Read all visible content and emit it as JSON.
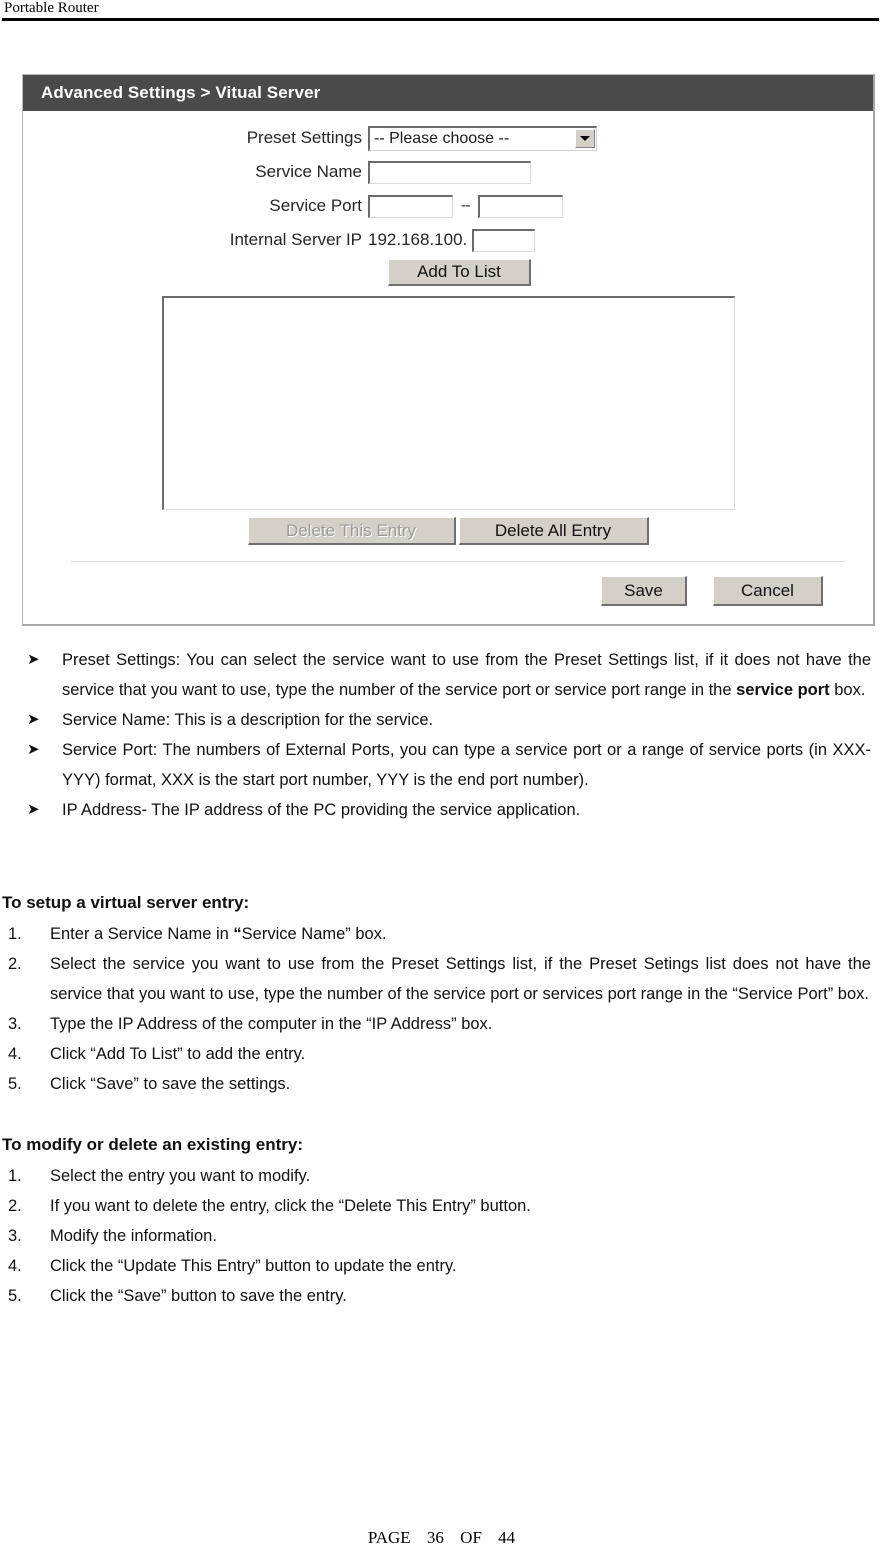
{
  "document": {
    "running_header": "Portable Router",
    "footer": {
      "page_word": "PAGE",
      "page_number": "36",
      "of_word": "OF",
      "total_pages": "44"
    }
  },
  "router_ui": {
    "titlebar": "Advanced Settings > Vitual Server",
    "form": {
      "preset_settings_label": "Preset Settings",
      "preset_settings_value": "-- Please choose --",
      "preset_settings_options": [
        "-- Please choose --"
      ],
      "service_name_label": "Service Name",
      "service_name_value": "",
      "service_port_label": "Service Port",
      "service_port_start_value": "",
      "service_port_end_value": "",
      "service_port_separator": "--",
      "internal_server_ip_label": "Internal Server IP",
      "internal_server_ip_prefix": "192.168.100.",
      "internal_server_ip_host_value": ""
    },
    "buttons": {
      "add_to_list": "Add To List",
      "delete_this_entry": "Delete This Entry",
      "delete_all_entry": "Delete All Entry",
      "save": "Save",
      "cancel": "Cancel"
    },
    "entry_list": {
      "items": []
    },
    "colors": {
      "titlebar_bg": "#4a4a4a",
      "titlebar_text": "#ffffff",
      "button_face": "#d4d0c8",
      "panel_bg": "#ffffff",
      "disabled_text": "#9a9a9a"
    }
  },
  "content": {
    "bullets": [
      {
        "pre": "Preset Settings: You can select the service want to use from the Preset Settings list, if it does not have the service that you want to use, type the number of the service port or service port range in the ",
        "bold": "service port",
        "post": " box."
      },
      {
        "pre": "Service Name: This is a description for the service.",
        "bold": "",
        "post": ""
      },
      {
        "pre": "Service Port: The numbers of External Ports, you can type a service port or a range of service ports (in XXX-YYY) format, XXX is the start port number, YYY is the end port number).",
        "bold": "",
        "post": ""
      },
      {
        "pre": "IP Address- The IP address of the PC providing the service application.",
        "bold": "",
        "post": ""
      }
    ],
    "setup_section": {
      "title": "To setup a virtual server entry:",
      "steps": [
        {
          "num": "1.",
          "pre": "Enter a Service Name in ",
          "bold": "“",
          "post": "Service Name” box."
        },
        {
          "num": "2.",
          "pre": "Select the service you want to use from the Preset Settings list, if the Preset Setings list does not have the service that you want to use, type the number of the service port or services port range in the “Service Port” box.",
          "bold": "",
          "post": ""
        },
        {
          "num": "3.",
          "pre": "Type the IP Address of the computer in the “IP Address” box.",
          "bold": "",
          "post": ""
        },
        {
          "num": "4.",
          "pre": "Click “Add To List” to add the entry.",
          "bold": "",
          "post": ""
        },
        {
          "num": "5.",
          "pre": "Click “Save” to save the settings.",
          "bold": "",
          "post": ""
        }
      ]
    },
    "modify_section": {
      "title": "To modify or delete an existing entry:",
      "steps": [
        {
          "num": "1.",
          "pre": "Select the entry you want to modify.",
          "bold": "",
          "post": ""
        },
        {
          "num": "2.",
          "pre": "If you want to delete the entry, click the “Delete This Entry” button.",
          "bold": "",
          "post": ""
        },
        {
          "num": "3.",
          "pre": "Modify the information.",
          "bold": "",
          "post": ""
        },
        {
          "num": "4.",
          "pre": "Click the “Update This Entry” button to update the entry.",
          "bold": "",
          "post": ""
        },
        {
          "num": "5.",
          "pre": "Click the “Save” button to save the entry.",
          "bold": "",
          "post": ""
        }
      ]
    },
    "bullet_glyph": "➤"
  }
}
